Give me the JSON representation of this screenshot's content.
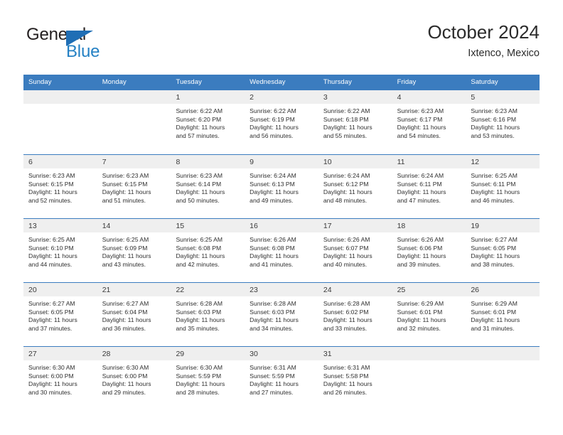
{
  "logo": {
    "word_one": "General",
    "word_two": "Blue",
    "triangle_color": "#1f6eb5",
    "word_two_color": "#2581c4"
  },
  "header": {
    "title": "October 2024",
    "subtitle": "Ixtenco, Mexico"
  },
  "theme": {
    "header_blue": "#3b7cbf",
    "day_band_gray": "#efefef",
    "text_color": "#2f2f2f"
  },
  "day_names": [
    "Sunday",
    "Monday",
    "Tuesday",
    "Wednesday",
    "Thursday",
    "Friday",
    "Saturday"
  ],
  "weeks": [
    [
      {
        "empty": true
      },
      {
        "empty": true
      },
      {
        "day": "1",
        "lines": [
          "Sunrise: 6:22 AM",
          "Sunset: 6:20 PM",
          "Daylight: 11 hours",
          "and 57 minutes."
        ]
      },
      {
        "day": "2",
        "lines": [
          "Sunrise: 6:22 AM",
          "Sunset: 6:19 PM",
          "Daylight: 11 hours",
          "and 56 minutes."
        ]
      },
      {
        "day": "3",
        "lines": [
          "Sunrise: 6:22 AM",
          "Sunset: 6:18 PM",
          "Daylight: 11 hours",
          "and 55 minutes."
        ]
      },
      {
        "day": "4",
        "lines": [
          "Sunrise: 6:23 AM",
          "Sunset: 6:17 PM",
          "Daylight: 11 hours",
          "and 54 minutes."
        ]
      },
      {
        "day": "5",
        "lines": [
          "Sunrise: 6:23 AM",
          "Sunset: 6:16 PM",
          "Daylight: 11 hours",
          "and 53 minutes."
        ]
      }
    ],
    [
      {
        "day": "6",
        "lines": [
          "Sunrise: 6:23 AM",
          "Sunset: 6:15 PM",
          "Daylight: 11 hours",
          "and 52 minutes."
        ]
      },
      {
        "day": "7",
        "lines": [
          "Sunrise: 6:23 AM",
          "Sunset: 6:15 PM",
          "Daylight: 11 hours",
          "and 51 minutes."
        ]
      },
      {
        "day": "8",
        "lines": [
          "Sunrise: 6:23 AM",
          "Sunset: 6:14 PM",
          "Daylight: 11 hours",
          "and 50 minutes."
        ]
      },
      {
        "day": "9",
        "lines": [
          "Sunrise: 6:24 AM",
          "Sunset: 6:13 PM",
          "Daylight: 11 hours",
          "and 49 minutes."
        ]
      },
      {
        "day": "10",
        "lines": [
          "Sunrise: 6:24 AM",
          "Sunset: 6:12 PM",
          "Daylight: 11 hours",
          "and 48 minutes."
        ]
      },
      {
        "day": "11",
        "lines": [
          "Sunrise: 6:24 AM",
          "Sunset: 6:11 PM",
          "Daylight: 11 hours",
          "and 47 minutes."
        ]
      },
      {
        "day": "12",
        "lines": [
          "Sunrise: 6:25 AM",
          "Sunset: 6:11 PM",
          "Daylight: 11 hours",
          "and 46 minutes."
        ]
      }
    ],
    [
      {
        "day": "13",
        "lines": [
          "Sunrise: 6:25 AM",
          "Sunset: 6:10 PM",
          "Daylight: 11 hours",
          "and 44 minutes."
        ]
      },
      {
        "day": "14",
        "lines": [
          "Sunrise: 6:25 AM",
          "Sunset: 6:09 PM",
          "Daylight: 11 hours",
          "and 43 minutes."
        ]
      },
      {
        "day": "15",
        "lines": [
          "Sunrise: 6:25 AM",
          "Sunset: 6:08 PM",
          "Daylight: 11 hours",
          "and 42 minutes."
        ]
      },
      {
        "day": "16",
        "lines": [
          "Sunrise: 6:26 AM",
          "Sunset: 6:08 PM",
          "Daylight: 11 hours",
          "and 41 minutes."
        ]
      },
      {
        "day": "17",
        "lines": [
          "Sunrise: 6:26 AM",
          "Sunset: 6:07 PM",
          "Daylight: 11 hours",
          "and 40 minutes."
        ]
      },
      {
        "day": "18",
        "lines": [
          "Sunrise: 6:26 AM",
          "Sunset: 6:06 PM",
          "Daylight: 11 hours",
          "and 39 minutes."
        ]
      },
      {
        "day": "19",
        "lines": [
          "Sunrise: 6:27 AM",
          "Sunset: 6:05 PM",
          "Daylight: 11 hours",
          "and 38 minutes."
        ]
      }
    ],
    [
      {
        "day": "20",
        "lines": [
          "Sunrise: 6:27 AM",
          "Sunset: 6:05 PM",
          "Daylight: 11 hours",
          "and 37 minutes."
        ]
      },
      {
        "day": "21",
        "lines": [
          "Sunrise: 6:27 AM",
          "Sunset: 6:04 PM",
          "Daylight: 11 hours",
          "and 36 minutes."
        ]
      },
      {
        "day": "22",
        "lines": [
          "Sunrise: 6:28 AM",
          "Sunset: 6:03 PM",
          "Daylight: 11 hours",
          "and 35 minutes."
        ]
      },
      {
        "day": "23",
        "lines": [
          "Sunrise: 6:28 AM",
          "Sunset: 6:03 PM",
          "Daylight: 11 hours",
          "and 34 minutes."
        ]
      },
      {
        "day": "24",
        "lines": [
          "Sunrise: 6:28 AM",
          "Sunset: 6:02 PM",
          "Daylight: 11 hours",
          "and 33 minutes."
        ]
      },
      {
        "day": "25",
        "lines": [
          "Sunrise: 6:29 AM",
          "Sunset: 6:01 PM",
          "Daylight: 11 hours",
          "and 32 minutes."
        ]
      },
      {
        "day": "26",
        "lines": [
          "Sunrise: 6:29 AM",
          "Sunset: 6:01 PM",
          "Daylight: 11 hours",
          "and 31 minutes."
        ]
      }
    ],
    [
      {
        "day": "27",
        "lines": [
          "Sunrise: 6:30 AM",
          "Sunset: 6:00 PM",
          "Daylight: 11 hours",
          "and 30 minutes."
        ]
      },
      {
        "day": "28",
        "lines": [
          "Sunrise: 6:30 AM",
          "Sunset: 6:00 PM",
          "Daylight: 11 hours",
          "and 29 minutes."
        ]
      },
      {
        "day": "29",
        "lines": [
          "Sunrise: 6:30 AM",
          "Sunset: 5:59 PM",
          "Daylight: 11 hours",
          "and 28 minutes."
        ]
      },
      {
        "day": "30",
        "lines": [
          "Sunrise: 6:31 AM",
          "Sunset: 5:59 PM",
          "Daylight: 11 hours",
          "and 27 minutes."
        ]
      },
      {
        "day": "31",
        "lines": [
          "Sunrise: 6:31 AM",
          "Sunset: 5:58 PM",
          "Daylight: 11 hours",
          "and 26 minutes."
        ]
      },
      {
        "empty": true
      },
      {
        "empty": true
      }
    ]
  ]
}
